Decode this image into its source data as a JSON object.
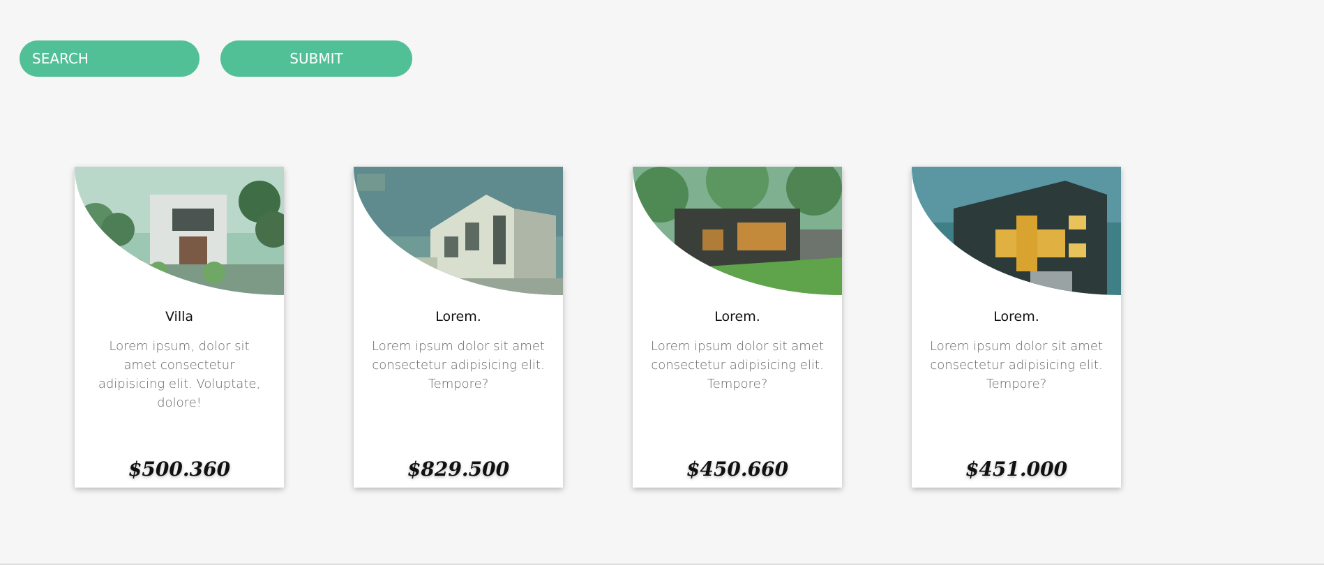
{
  "search": {
    "placeholder": "SEARCH",
    "submit_label": "SUBMIT"
  },
  "cards": [
    {
      "title": "Villa",
      "description": "Lorem ipsum, dolor sit amet consectetur adipisicing elit. Voluptate, dolore!",
      "price": "$500.360",
      "image": "villa-photo"
    },
    {
      "title": "Lorem.",
      "description": "Lorem ipsum dolor sit amet consectetur adipisicing elit. Tempore?",
      "price": "$829.500",
      "image": "apartment-building-photo"
    },
    {
      "title": "Lorem.",
      "description": "Lorem ipsum dolor sit amet consectetur adipisicing elit. Tempore?",
      "price": "$450.660",
      "image": "modern-house-photo"
    },
    {
      "title": "Lorem.",
      "description": "Lorem ipsum dolor sit amet consectetur adipisicing elit. Tempore?",
      "price": "$451.000",
      "image": "night-house-photo"
    }
  ],
  "colors": {
    "accent": "#52c096",
    "background": "#f6f6f6",
    "card": "#ffffff"
  }
}
